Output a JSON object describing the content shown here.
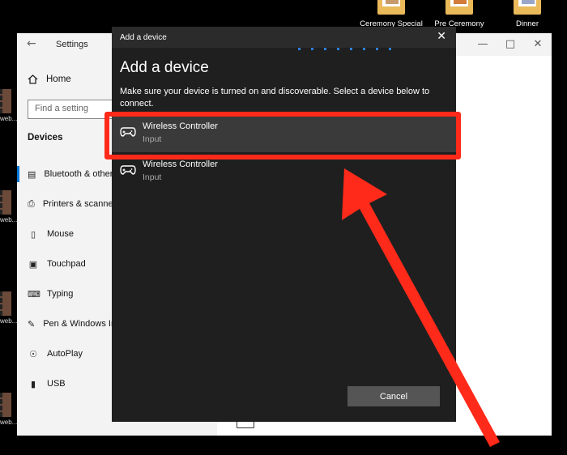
{
  "desktop": {
    "icons": [
      {
        "label": "Ceremony Special"
      },
      {
        "label": "Pre Ceremony"
      },
      {
        "label": "Dinner"
      }
    ],
    "thumb_label": "web..."
  },
  "settings": {
    "title": "Settings",
    "home_label": "Home",
    "search_placeholder": "Find a setting",
    "section_title": "Devices",
    "nav_items": [
      {
        "label": "Bluetooth & other devices",
        "icon": "bluetooth-devices-icon"
      },
      {
        "label": "Printers & scanners",
        "icon": "printer-icon"
      },
      {
        "label": "Mouse",
        "icon": "mouse-icon"
      },
      {
        "label": "Touchpad",
        "icon": "touchpad-icon"
      },
      {
        "label": "Typing",
        "icon": "keyboard-icon"
      },
      {
        "label": "Pen & Windows Ink",
        "icon": "pen-icon"
      },
      {
        "label": "AutoPlay",
        "icon": "autoplay-icon"
      },
      {
        "label": "USB",
        "icon": "usb-icon"
      }
    ],
    "accent": "#0078d7"
  },
  "dialog": {
    "title_bar": "Add a device",
    "heading": "Add a device",
    "description": "Make sure your device is turned on and discoverable. Select a device below to connect.",
    "devices": [
      {
        "name": "Wireless Controller",
        "type": "Input",
        "selected": true,
        "icon": "gamepad-icon"
      },
      {
        "name": "Wireless Controller",
        "type": "Input",
        "selected": false,
        "icon": "gamepad-icon"
      }
    ],
    "cancel_label": "Cancel"
  },
  "annotation": {
    "color": "#ff2a1a"
  }
}
